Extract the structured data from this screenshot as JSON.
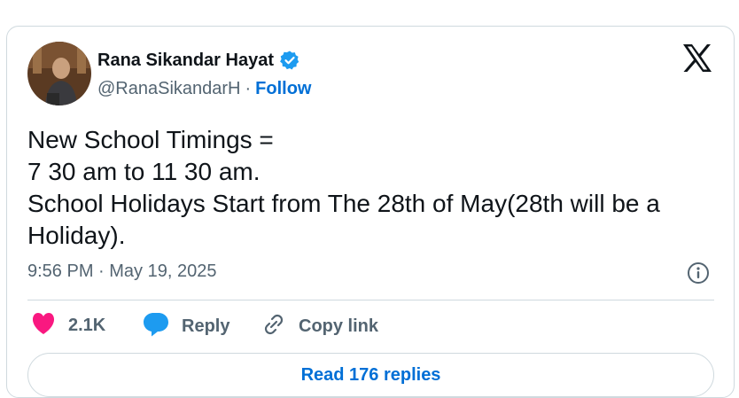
{
  "author": {
    "name": "Rana Sikandar Hayat",
    "handle": "@RanaSikandarH",
    "separator": "·",
    "follow_label": "Follow"
  },
  "tweet": {
    "lines": [
      "New School Timings =",
      "7 30 am to 11 30 am.",
      "School Holidays Start from The 28th of May(28th will be a",
      "Holiday)."
    ],
    "timestamp": "9:56 PM · May 19, 2025"
  },
  "actions": {
    "like_count": "2.1K",
    "reply_label": "Reply",
    "copy_link_label": "Copy link"
  },
  "read_replies_label": "Read 176 replies",
  "colors": {
    "like": "#f91880",
    "reply": "#1d9bf0",
    "link": "#006fd6",
    "muted": "#536471",
    "border": "#cfd9de"
  },
  "icons": [
    "verified-badge-icon",
    "x-logo-icon",
    "info-icon",
    "heart-icon",
    "reply-bubble-icon",
    "link-icon"
  ]
}
